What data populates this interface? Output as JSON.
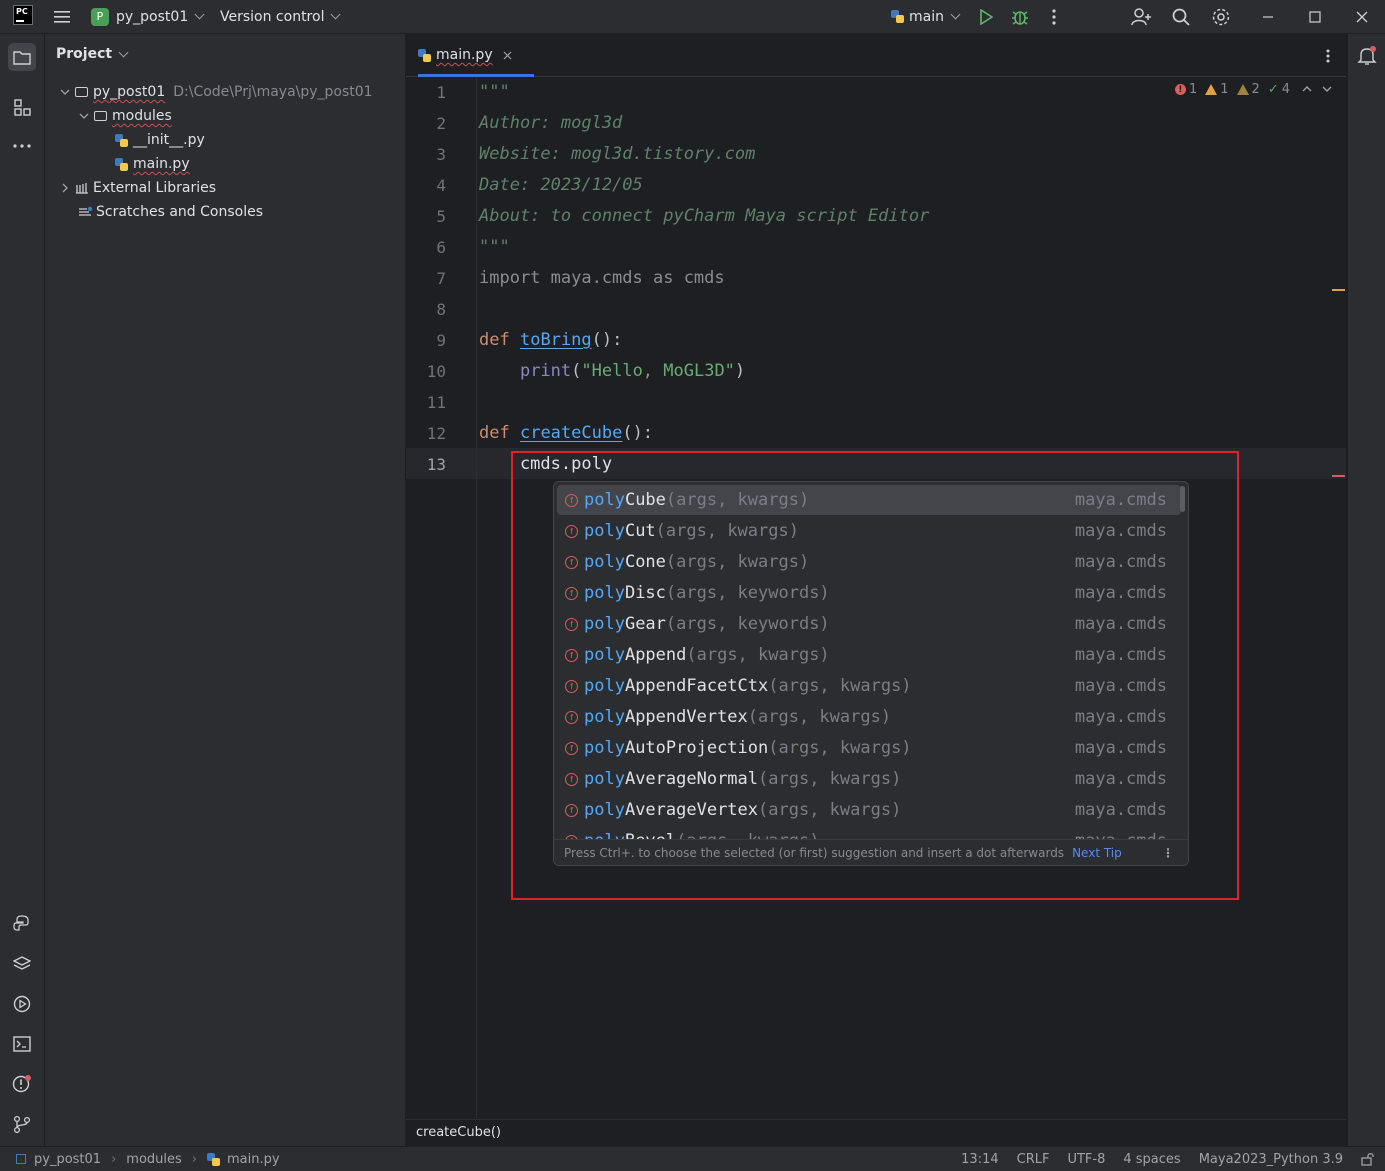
{
  "titlebar": {
    "project_badge": "P",
    "project_name": "py_post01",
    "vcs": "Version control",
    "run_config": "main"
  },
  "project_panel": {
    "title": "Project",
    "tree": [
      {
        "label": "py_post01",
        "path": "D:\\Code\\Prj\\maya\\py_post01"
      },
      {
        "label": "modules"
      },
      {
        "label": "__init__.py"
      },
      {
        "label": "main.py"
      },
      {
        "label": "External Libraries"
      },
      {
        "label": "Scratches and Consoles"
      }
    ]
  },
  "tab": {
    "label": "main.py"
  },
  "inspections": {
    "errors": "1",
    "warnings": "1",
    "weak_warnings": "2",
    "typos": "4"
  },
  "editor": {
    "line_numbers": [
      "1",
      "2",
      "3",
      "4",
      "5",
      "6",
      "7",
      "8",
      "9",
      "10",
      "11",
      "12",
      "13"
    ],
    "lines": [
      "\"\"\"",
      "Author: mogl3d",
      "Website: mogl3d.tistory.com",
      "Date: 2023/12/05",
      "About: to connect pyCharm Maya script Editor",
      "\"\"\"",
      "import maya.cmds as cmds",
      "",
      "def toBring():",
      "    print(\"Hello, MoGL3D\")",
      "",
      "def createCube():",
      "    cmds.poly"
    ]
  },
  "completion": {
    "items": [
      {
        "prefix": "poly",
        "rest": "Cube",
        "args": "(args, kwargs)",
        "source": "maya.cmds"
      },
      {
        "prefix": "poly",
        "rest": "Cut",
        "args": "(args, kwargs)",
        "source": "maya.cmds"
      },
      {
        "prefix": "poly",
        "rest": "Cone",
        "args": "(args, kwargs)",
        "source": "maya.cmds"
      },
      {
        "prefix": "poly",
        "rest": "Disc",
        "args": "(args, keywords)",
        "source": "maya.cmds"
      },
      {
        "prefix": "poly",
        "rest": "Gear",
        "args": "(args, keywords)",
        "source": "maya.cmds"
      },
      {
        "prefix": "poly",
        "rest": "Append",
        "args": "(args, kwargs)",
        "source": "maya.cmds"
      },
      {
        "prefix": "poly",
        "rest": "AppendFacetCtx",
        "args": "(args, kwargs)",
        "source": "maya.cmds"
      },
      {
        "prefix": "poly",
        "rest": "AppendVertex",
        "args": "(args, kwargs)",
        "source": "maya.cmds"
      },
      {
        "prefix": "poly",
        "rest": "AutoProjection",
        "args": "(args, kwargs)",
        "source": "maya.cmds"
      },
      {
        "prefix": "poly",
        "rest": "AverageNormal",
        "args": "(args, kwargs)",
        "source": "maya.cmds"
      },
      {
        "prefix": "poly",
        "rest": "AverageVertex",
        "args": "(args, kwargs)",
        "source": "maya.cmds"
      },
      {
        "prefix": "poly",
        "rest": "Bevel",
        "args": "(args, kwargs)",
        "source": "maya.cmds"
      }
    ],
    "footer_hint": "Press Ctrl+. to choose the selected (or first) suggestion and insert a dot afterwards",
    "next_tip": "Next Tip"
  },
  "editor_breadcrumb": "createCube()",
  "statusbar": {
    "crumbs": [
      "py_post01",
      "modules",
      "main.py"
    ],
    "position": "13:14",
    "line_sep": "CRLF",
    "encoding": "UTF-8",
    "indent": "4 spaces",
    "interpreter": "Maya2023_Python 3.9"
  },
  "colors": {
    "accent": "#3574f0",
    "highlight_box": "#e0202a",
    "error": "#db5c5c"
  },
  "icons": [
    "menu-icon",
    "run-icon",
    "debug-icon",
    "more-icon",
    "add-user-icon",
    "search-icon",
    "gear-icon",
    "minimize-icon",
    "maximize-icon",
    "close-icon",
    "folder-icon",
    "structure-icon",
    "python-console-icon",
    "layers-icon",
    "services-icon",
    "terminal-icon",
    "problems-icon",
    "git-icon",
    "bell-icon"
  ]
}
